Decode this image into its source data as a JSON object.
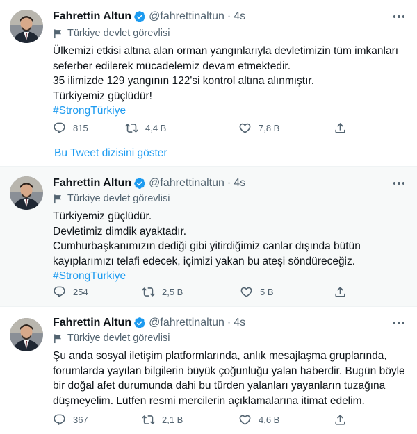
{
  "tweets": [
    {
      "author": {
        "name": "Fahrettin Altun",
        "handle": "@fahrettinaltun",
        "separator": "·",
        "time": "4s"
      },
      "label": "Türkiye devlet görevlisi",
      "body": [
        "Ülkemizi etkisi altına alan orman yangınlarıyla devletimizin tüm imkanları",
        "seferber edilerek mücadelemiz devam etmektedir.",
        "35 ilimizde 129 yangının 122'si kontrol altına alınmıştır.",
        "Türkiyemiz güçlüdür!"
      ],
      "hashtag": "#StrongTürkiye",
      "counts": {
        "reply": "815",
        "retweet": "4,4 B",
        "like": "7,8 B"
      },
      "show_thread": "Bu Tweet dizisini göster"
    },
    {
      "author": {
        "name": "Fahrettin Altun",
        "handle": "@fahrettinaltun",
        "separator": "·",
        "time": "4s"
      },
      "label": "Türkiye devlet görevlisi",
      "body": [
        "Türkiyemiz güçlüdür.",
        "Devletimiz dimdik ayaktadır.",
        "Cumhurbaşkanımızın dediği gibi yitirdiğimiz canlar dışında bütün",
        "kayıplarımızı telafi edecek, içimizi yakan bu ateşi söndüreceğiz."
      ],
      "hashtag": "#StrongTürkiye",
      "counts": {
        "reply": "254",
        "retweet": "2,5 B",
        "like": "5 B"
      }
    },
    {
      "author": {
        "name": "Fahrettin Altun",
        "handle": "@fahrettinaltun",
        "separator": "·",
        "time": "4s"
      },
      "label": "Türkiye devlet görevlisi",
      "body": [
        "Şu anda sosyal iletişim platformlarında, anlık mesajlaşma gruplarında,",
        "forumlarda yayılan bilgilerin büyük çoğunluğu yalan haberdir. Bugün böyle",
        "bir doğal afet durumunda dahi bu türden yalanları yayanların tuzağına",
        "düşmeyelim. Lütfen resmi mercilerin açıklamalarına itimat edelim."
      ],
      "counts": {
        "reply": "367",
        "retweet": "2,1 B",
        "like": "4,6 B"
      }
    }
  ],
  "colors": {
    "link": "#1d9bf0",
    "verified": "#1d9bf0",
    "muted": "#536471",
    "text": "#0f1419",
    "highlight_bg": "#f7f9f9"
  },
  "icons": [
    "verified-badge-icon",
    "more-options-icon",
    "flag-icon",
    "reply-icon",
    "retweet-icon",
    "like-icon",
    "share-icon"
  ]
}
